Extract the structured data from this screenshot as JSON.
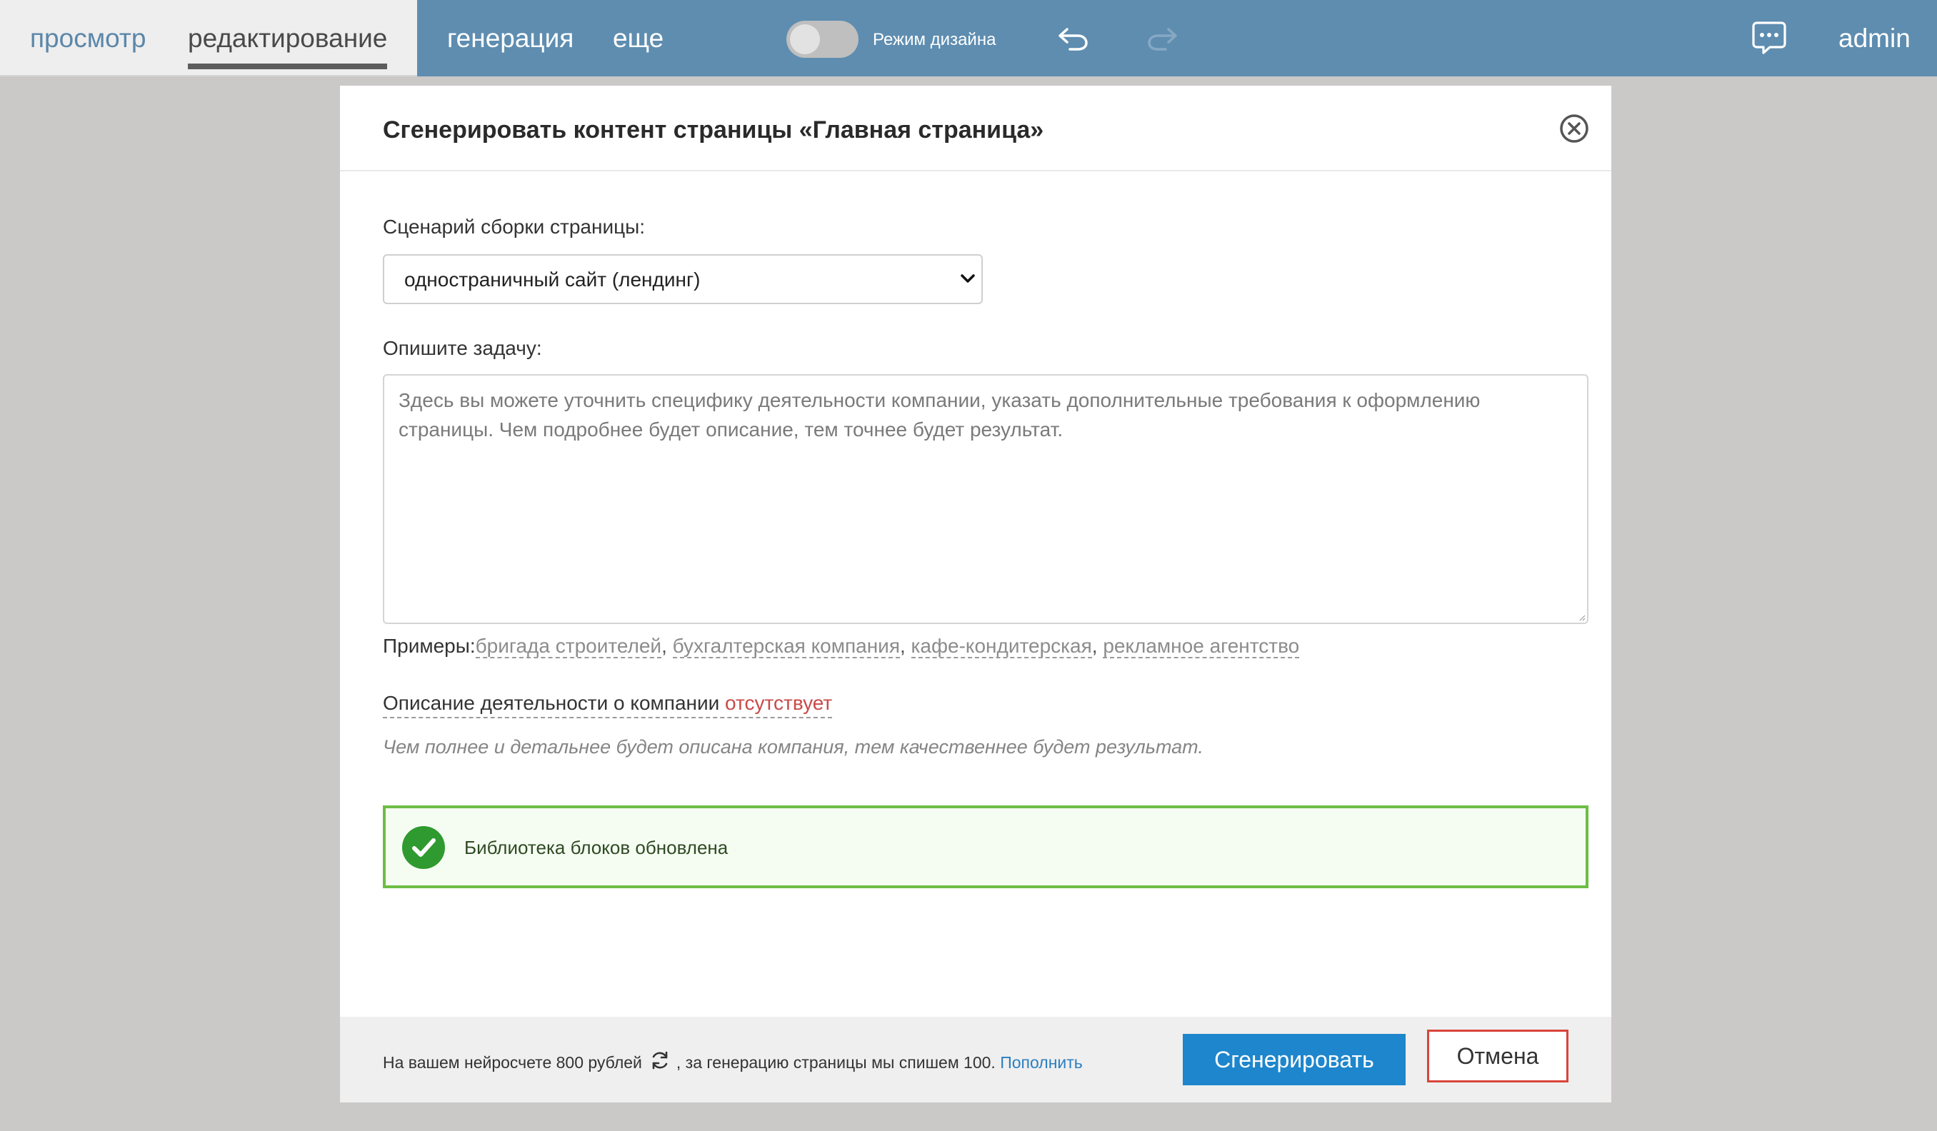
{
  "topbar": {
    "tabs": {
      "view": "просмотр",
      "edit": "редактирование",
      "generate": "генерация",
      "more": "еще"
    },
    "design_mode_label": "Режим дизайна",
    "design_mode_on": false,
    "user": "admin",
    "colors": {
      "bar": "#5e8db0",
      "left_bg": "#eeeeee",
      "active_tab": "#4a4a4a",
      "inactive_tab": "#5b87a9"
    }
  },
  "modal": {
    "title": "Сгенерировать контент страницы «Главная страница»",
    "scenario": {
      "label": "Сценарий сборки страницы:",
      "selected": "одностраничный сайт (лендинг)"
    },
    "task": {
      "label": "Опишите задачу:",
      "placeholder": "Здесь вы можете уточнить специфику деятельности компании, указать дополнительные требования к оформлению страницы. Чем подробнее будет описание, тем точнее будет результат.",
      "value": ""
    },
    "examples": {
      "label": "Примеры:",
      "items": [
        "бригада строителей",
        "бухгалтерская компания",
        "кафе-кондитерская",
        "рекламное агентство"
      ]
    },
    "company_description": {
      "text": "Описание деятельности о компании",
      "status": "отсутствует"
    },
    "hint": "Чем полнее и детальнее будет описана компания, тем качественнее будет результат.",
    "success_message": "Библиотека блоков обновлена",
    "footer": {
      "balance_text": "На вашем нейросчете 800 рублей",
      "charge_text": ", за генерацию страницы мы спишем 100.",
      "topup_link": "Пополнить",
      "generate_button": "Сгенерировать",
      "cancel_button": "Отмена"
    },
    "colors": {
      "primary": "#1e86cc",
      "success_border": "#6dbd45",
      "success_icon": "#2f9a2f",
      "danger": "#d9443a",
      "missing": "#c94a4a"
    }
  },
  "icons": [
    "undo-icon",
    "redo-icon",
    "chat-icon",
    "close-icon",
    "chevron-down-icon",
    "check-circle-icon",
    "refresh-icon"
  ]
}
